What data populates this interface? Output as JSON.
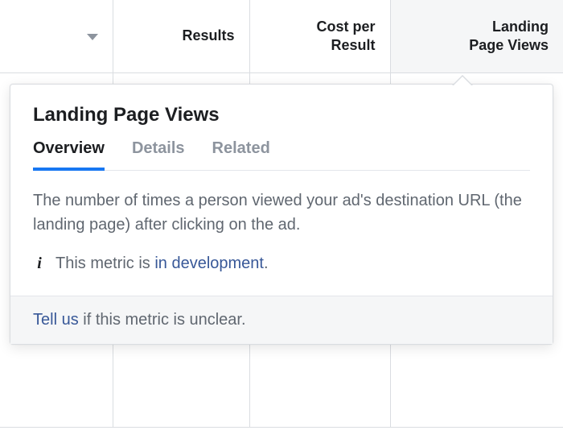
{
  "columns": {
    "results": "Results",
    "cost_line1": "Cost per",
    "cost_line2": "Result",
    "landing_line1": "Landing",
    "landing_line2": "Page Views"
  },
  "popover": {
    "title": "Landing Page Views",
    "tabs": {
      "overview": "Overview",
      "details": "Details",
      "related": "Related"
    },
    "description": "The number of times a person viewed your ad's destination URL (the landing page) after clicking on the ad.",
    "note_prefix": "This metric is ",
    "note_link": "in development",
    "note_suffix": ".",
    "footer_link": "Tell us",
    "footer_rest": " if this metric is unclear."
  }
}
